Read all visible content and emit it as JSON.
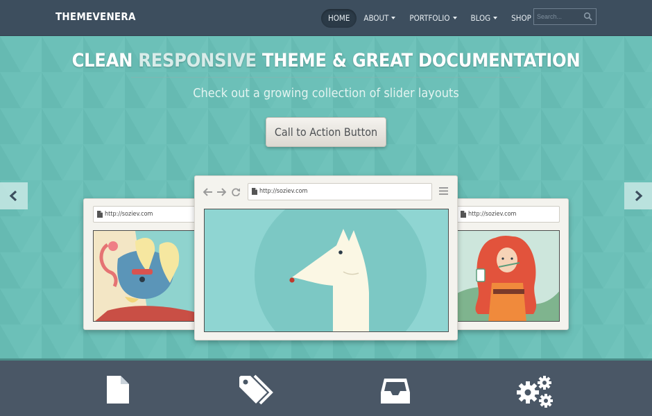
{
  "navbar": {
    "brand": "THEMEVENERA",
    "items": [
      {
        "label": "HOME",
        "active": true,
        "dropdown": false
      },
      {
        "label": "ABOUT",
        "active": false,
        "dropdown": true
      },
      {
        "label": "PORTFOLIO",
        "active": false,
        "dropdown": true
      },
      {
        "label": "BLOG",
        "active": false,
        "dropdown": true
      },
      {
        "label": "SHOP",
        "active": false,
        "dropdown": true
      }
    ],
    "search": {
      "placeholder": "Search...",
      "icon": "search-icon"
    }
  },
  "hero": {
    "headline_part1": "CLEAN ",
    "headline_accent": "RESPONSIVE",
    "headline_part2": " THEME & GREAT DOCUMENTATION",
    "subtitle": "Check out a growing collection of slider layouts",
    "cta_label": "Call to Action Button",
    "prev_icon": "chevron-left-icon",
    "next_icon": "chevron-right-icon"
  },
  "slides": {
    "left": {
      "url": "http://soziev.com",
      "illustration": "flamingo-elephant-illustration"
    },
    "center": {
      "url": "http://soziev.com",
      "illustration": "white-dog-illustration"
    },
    "right": {
      "url": "http://soziev.com",
      "illustration": "red-haired-girl-illustration"
    }
  },
  "features": {
    "icons": [
      "document-icon",
      "tags-icon",
      "inbox-icon",
      "gears-icon"
    ]
  },
  "colors": {
    "navbar": "#3d4e5e",
    "hero": "#6bbfb7",
    "features": "#4a5766",
    "accent": "#d8ece9"
  }
}
